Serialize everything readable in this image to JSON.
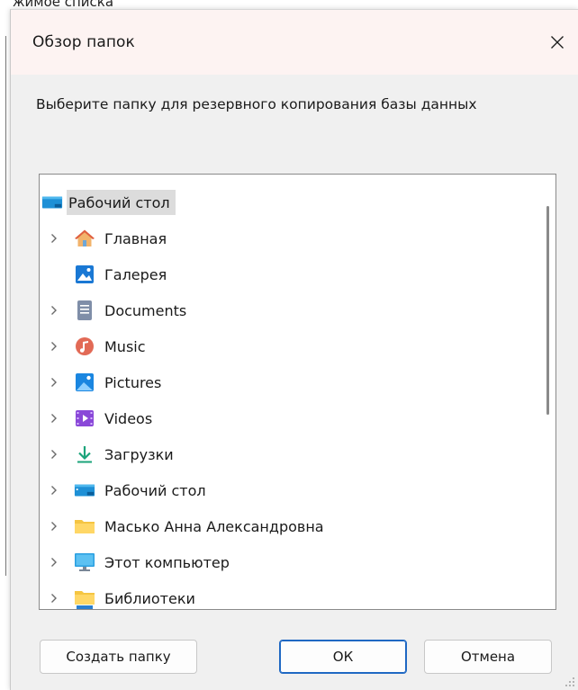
{
  "background": {
    "clipped_text": "жимое списка"
  },
  "dialog": {
    "title": "Обзор папок",
    "instruction": "Выберите папку для резервного копирования базы данных",
    "accent_color": "#1f68c3",
    "selected_item": "Рабочий стол"
  },
  "tree": {
    "items": [
      {
        "label": "Рабочий стол",
        "icon": "desktop-icon",
        "has_chevron": false
      },
      {
        "label": "Главная",
        "icon": "home-icon",
        "has_chevron": true
      },
      {
        "label": "Галерея",
        "icon": "gallery-icon",
        "has_chevron": false
      },
      {
        "label": "Documents",
        "icon": "documents-icon",
        "has_chevron": true
      },
      {
        "label": "Music",
        "icon": "music-icon",
        "has_chevron": true
      },
      {
        "label": "Pictures",
        "icon": "pictures-icon",
        "has_chevron": true
      },
      {
        "label": "Videos",
        "icon": "videos-icon",
        "has_chevron": true
      },
      {
        "label": "Загрузки",
        "icon": "downloads-icon",
        "has_chevron": true
      },
      {
        "label": "Рабочий стол",
        "icon": "desktop-icon",
        "has_chevron": true
      },
      {
        "label": "Масько Анна Александровна",
        "icon": "folder-icon",
        "has_chevron": true
      },
      {
        "label": "Этот компьютер",
        "icon": "computer-icon",
        "has_chevron": true
      },
      {
        "label": "Библиотеки",
        "icon": "libraries-icon",
        "has_chevron": true
      }
    ]
  },
  "buttons": {
    "new_folder": "Создать папку",
    "ok": "ОК",
    "cancel": "Отмена"
  }
}
